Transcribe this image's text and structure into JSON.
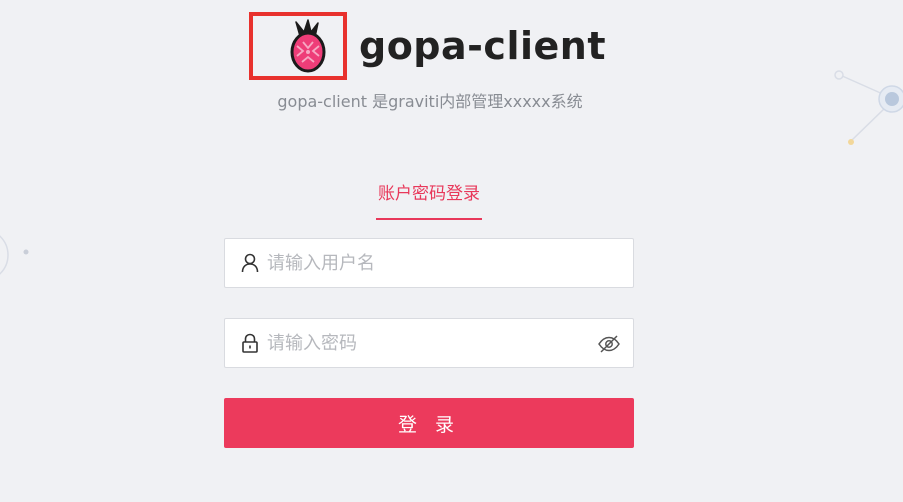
{
  "app": {
    "title": "gopa-client",
    "subtitle": "gopa-client 是graviti内部管理xxxxx系统"
  },
  "login": {
    "tab_label": "账户密码登录",
    "username_placeholder": "请输入用户名",
    "password_placeholder": "请输入密码",
    "submit_label": "登 录"
  },
  "icons": {
    "logo": "dragonfruit-logo-icon",
    "username": "user-icon",
    "password": "lock-icon",
    "toggle_password": "eye-off-icon"
  },
  "colors": {
    "accent": "#ec3a5c",
    "logo_highlight": "#e8312d",
    "background": "#f0f1f4"
  }
}
